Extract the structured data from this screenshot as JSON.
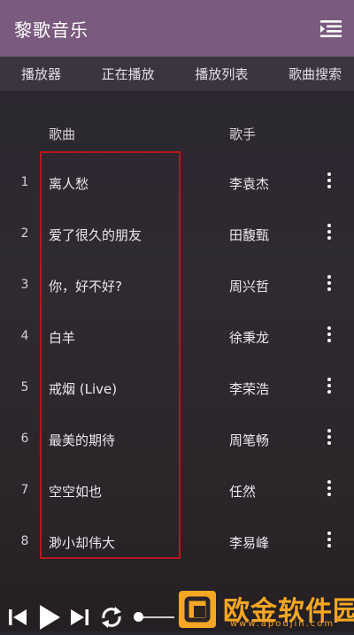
{
  "app": {
    "title": "黎歌音乐",
    "menu_icon": "list-menu-icon"
  },
  "tabs": [
    {
      "label": "播放器"
    },
    {
      "label": "正在播放"
    },
    {
      "label": "播放列表"
    },
    {
      "label": "歌曲搜索"
    }
  ],
  "table": {
    "headers": {
      "song": "歌曲",
      "artist": "歌手"
    },
    "rows": [
      {
        "num": "1",
        "song": "离人愁",
        "artist": "李袁杰"
      },
      {
        "num": "2",
        "song": "爱了很久的朋友",
        "artist": "田馥甄"
      },
      {
        "num": "3",
        "song": "你，好不好?",
        "artist": "周兴哲"
      },
      {
        "num": "4",
        "song": "白羊",
        "artist": "徐秉龙"
      },
      {
        "num": "5",
        "song": "戒烟 (Live)",
        "artist": "李荣浩"
      },
      {
        "num": "6",
        "song": "最美的期待",
        "artist": "周笔畅"
      },
      {
        "num": "7",
        "song": "空空如也",
        "artist": "任然"
      },
      {
        "num": "8",
        "song": "渺小却伟大",
        "artist": "李易峰"
      }
    ]
  },
  "player": {
    "icons": [
      "previous-icon",
      "play-icon",
      "next-icon",
      "repeat-icon"
    ]
  },
  "watermark": {
    "text": "欧金软件园",
    "url": "www.apoujin.com"
  },
  "colors": {
    "titlebar": "#7b5a7f",
    "tabbar": "#3b3540",
    "highlight": "#b8161e",
    "watermark": "#f5a623"
  }
}
